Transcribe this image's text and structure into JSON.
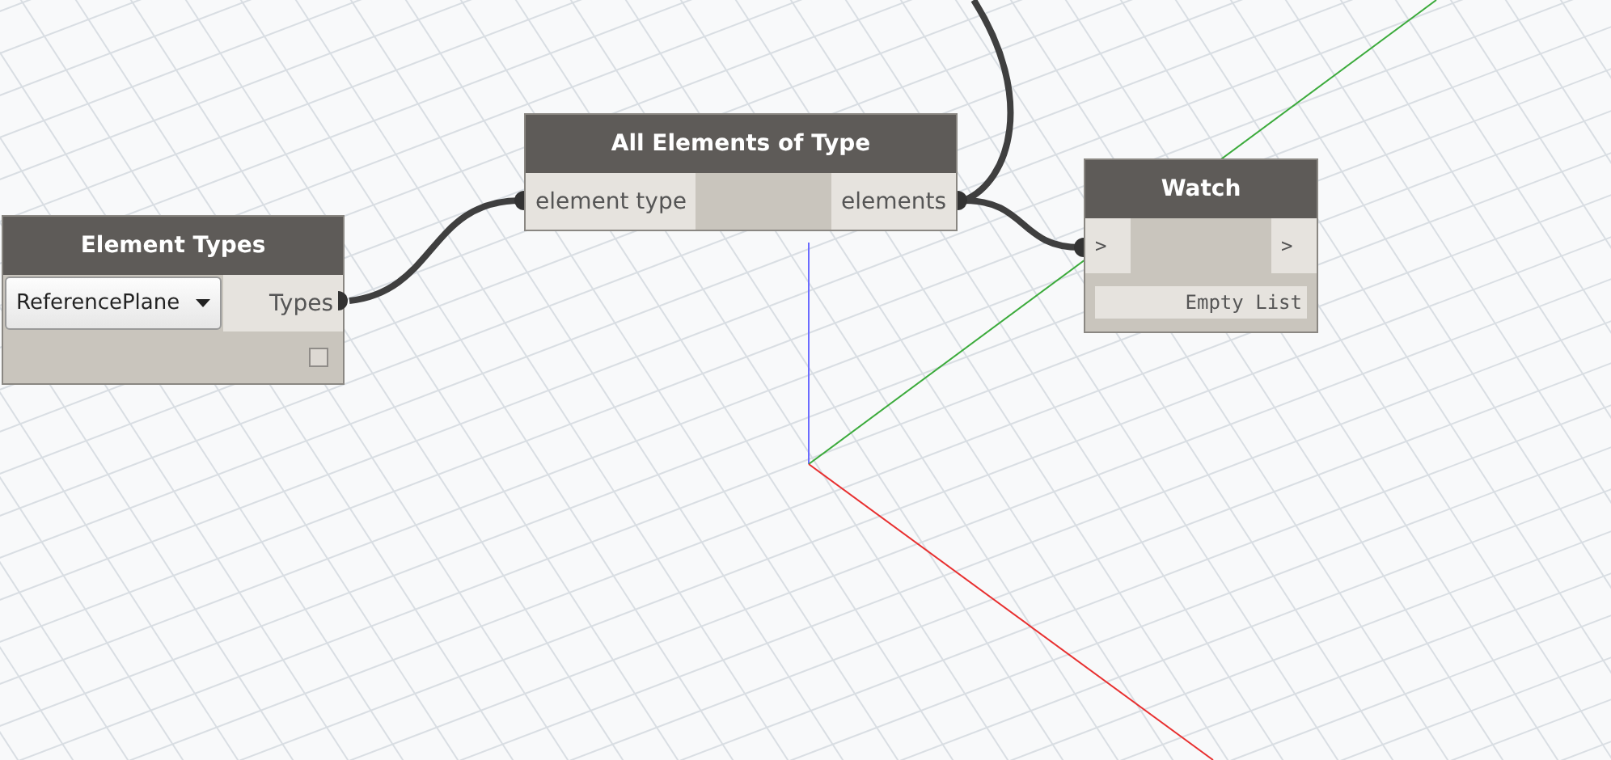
{
  "nodes": [
    {
      "kind": "selection",
      "title": "Element Types",
      "dropdown_value": "ReferencePlane",
      "outputs": [
        "Types"
      ],
      "preview_checked": false
    },
    {
      "kind": "function",
      "title": "All Elements of Type",
      "inputs": [
        "element type"
      ],
      "outputs": [
        "elements"
      ]
    },
    {
      "kind": "watch",
      "title": "Watch",
      "inputs": [
        ">"
      ],
      "outputs": [
        ">"
      ],
      "value": "Empty List"
    }
  ]
}
